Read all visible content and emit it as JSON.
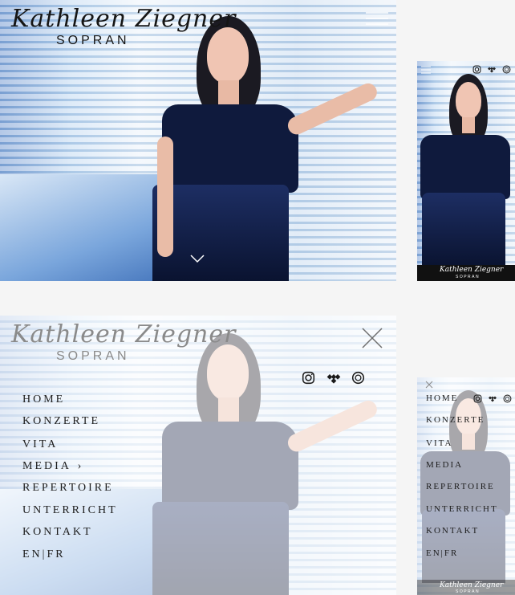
{
  "logo": {
    "script": "Kathleen Ziegner",
    "sub": "SOPRAN"
  },
  "nav": {
    "items": [
      {
        "label": "HOME"
      },
      {
        "label": "KONZERTE"
      },
      {
        "label": "VITA"
      },
      {
        "label": "MEDIA"
      },
      {
        "label": "REPERTOIRE"
      },
      {
        "label": "UNTERRICHT"
      },
      {
        "label": "KONTAKT"
      },
      {
        "label": "EN|FR"
      }
    ],
    "media_chevron": "›"
  },
  "icons": [
    "instagram-icon",
    "tidal-icon",
    "spotify-icon",
    "close-icon",
    "chevron-down-icon",
    "menu-icon"
  ]
}
